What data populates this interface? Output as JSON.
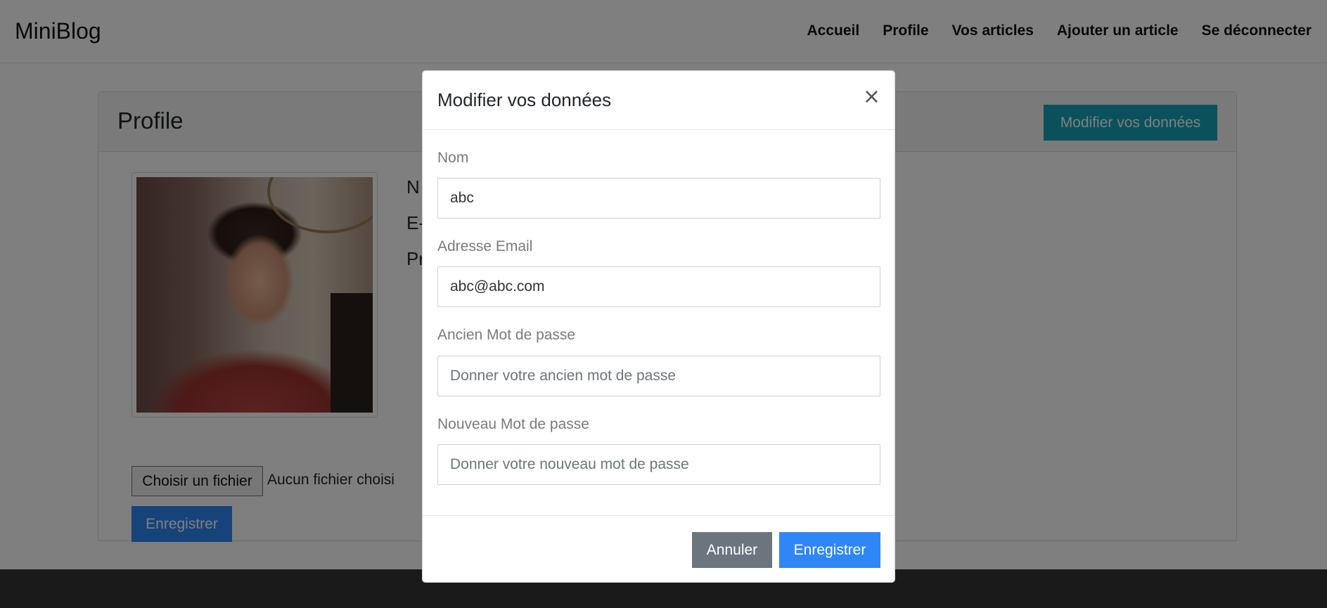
{
  "navbar": {
    "brand": "MiniBlog",
    "links": [
      "Accueil",
      "Profile",
      "Vos articles",
      "Ajouter un article",
      "Se déconnecter"
    ]
  },
  "profile": {
    "title": "Profile",
    "edit_button": "Modifier vos données",
    "info_lines": [
      "N",
      "E-",
      "Pr"
    ],
    "file_button": "Choisir un fichier",
    "file_status": "Aucun fichier choisi",
    "save_button": "Enregistrer"
  },
  "modal": {
    "title": "Modifier vos données",
    "close_symbol": "×",
    "fields": [
      {
        "label": "Nom",
        "value": "abc",
        "placeholder": ""
      },
      {
        "label": "Adresse Email",
        "value": "abc@abc.com",
        "placeholder": ""
      },
      {
        "label": "Ancien Mot de passe",
        "value": "",
        "placeholder": "Donner votre ancien mot de passe"
      },
      {
        "label": "Nouveau Mot de passe",
        "value": "",
        "placeholder": "Donner votre nouveau mot de passe"
      }
    ],
    "cancel_button": "Annuler",
    "save_button": "Enregistrer"
  },
  "colors": {
    "info": "#17a2b8",
    "primary": "#2f86f6",
    "secondary": "#6c757d",
    "footer": "#343434"
  }
}
